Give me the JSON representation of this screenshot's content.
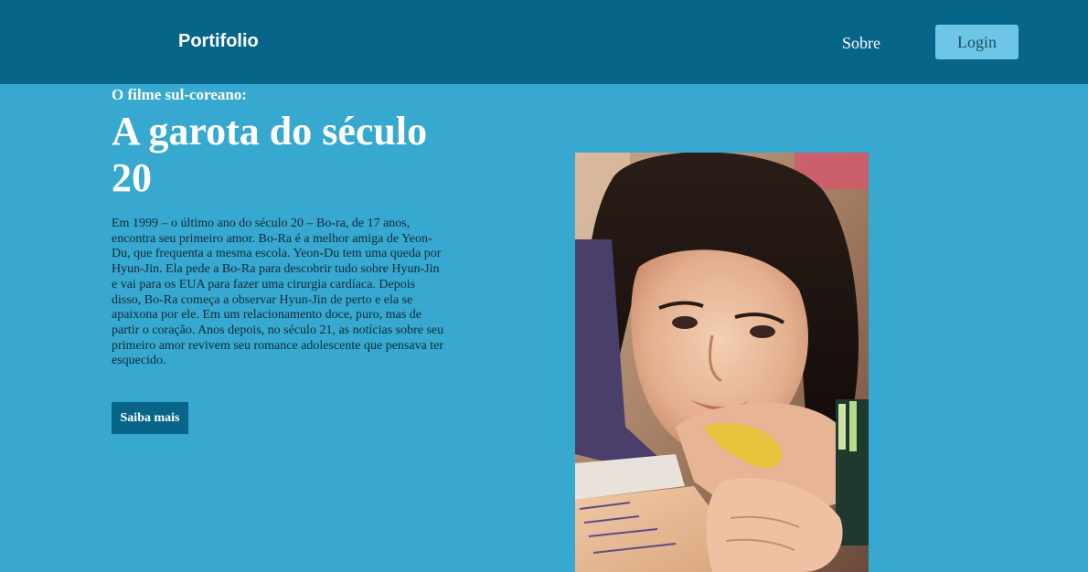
{
  "navbar": {
    "brand": "Portifolio",
    "links": [
      {
        "label": "Sobre"
      }
    ],
    "login_label": "Login"
  },
  "hero": {
    "kicker": "O filme sul-coreano:",
    "title": "A garota do século 20",
    "synopsis": "Em 1999 – o último ano do século 20 – Bo-ra, de 17 anos, encontra seu primeiro amor. Bo-Ra é a melhor amiga de Yeon-Du, que frequenta a mesma escola. Yeon-Du tem uma queda por Hyun-Jin. Ela pede a Bo-Ra para descobrir tudo sobre Hyun-Jin e vai para os EUA para fazer uma cirurgia cardíaca. Depois disso, Bo-Ra começa a observar Hyun-Jin de perto e ela se apaixona por ele. Em um relacionamento doce, puro, mas de partir o coração. Anos depois, no século 21, as notícias sobre seu primeiro amor revivem seu romance adolescente que pensava ter esquecido.",
    "cta_label": "Saiba mais"
  },
  "colors": {
    "navbar": "#07658a",
    "background": "#37a8cf",
    "login_button": "#6ec6e6",
    "cta_button": "#07658a"
  }
}
